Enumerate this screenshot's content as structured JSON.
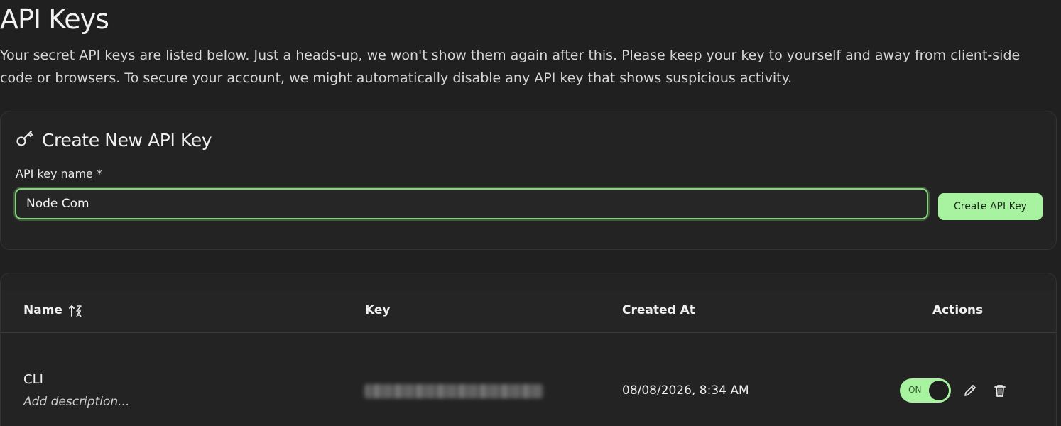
{
  "header": {
    "title": "API Keys",
    "description": "Your secret API keys are listed below. Just a heads-up, we won't show them again after this. Please keep your key to yourself and away from client-side code or browsers. To secure your account, we might automatically disable any API key that shows suspicious activity."
  },
  "create_form": {
    "title": "Create New API Key",
    "icon": "key-icon",
    "field_label": "API key name *",
    "field_value": "Node Com",
    "button_label": "Create API Key",
    "accent_color": "#a8f3a0"
  },
  "table": {
    "columns": [
      "Name",
      "Key",
      "Created At",
      "Actions"
    ],
    "sort_icon": "sort-icon",
    "rows": [
      {
        "name": "CLI",
        "description": "Add description...",
        "key_masked": true,
        "created_at": "08/08/2026, 8:34 AM",
        "toggle_label": "ON",
        "enabled": true,
        "actions": [
          "edit-icon",
          "delete-icon"
        ]
      }
    ]
  }
}
